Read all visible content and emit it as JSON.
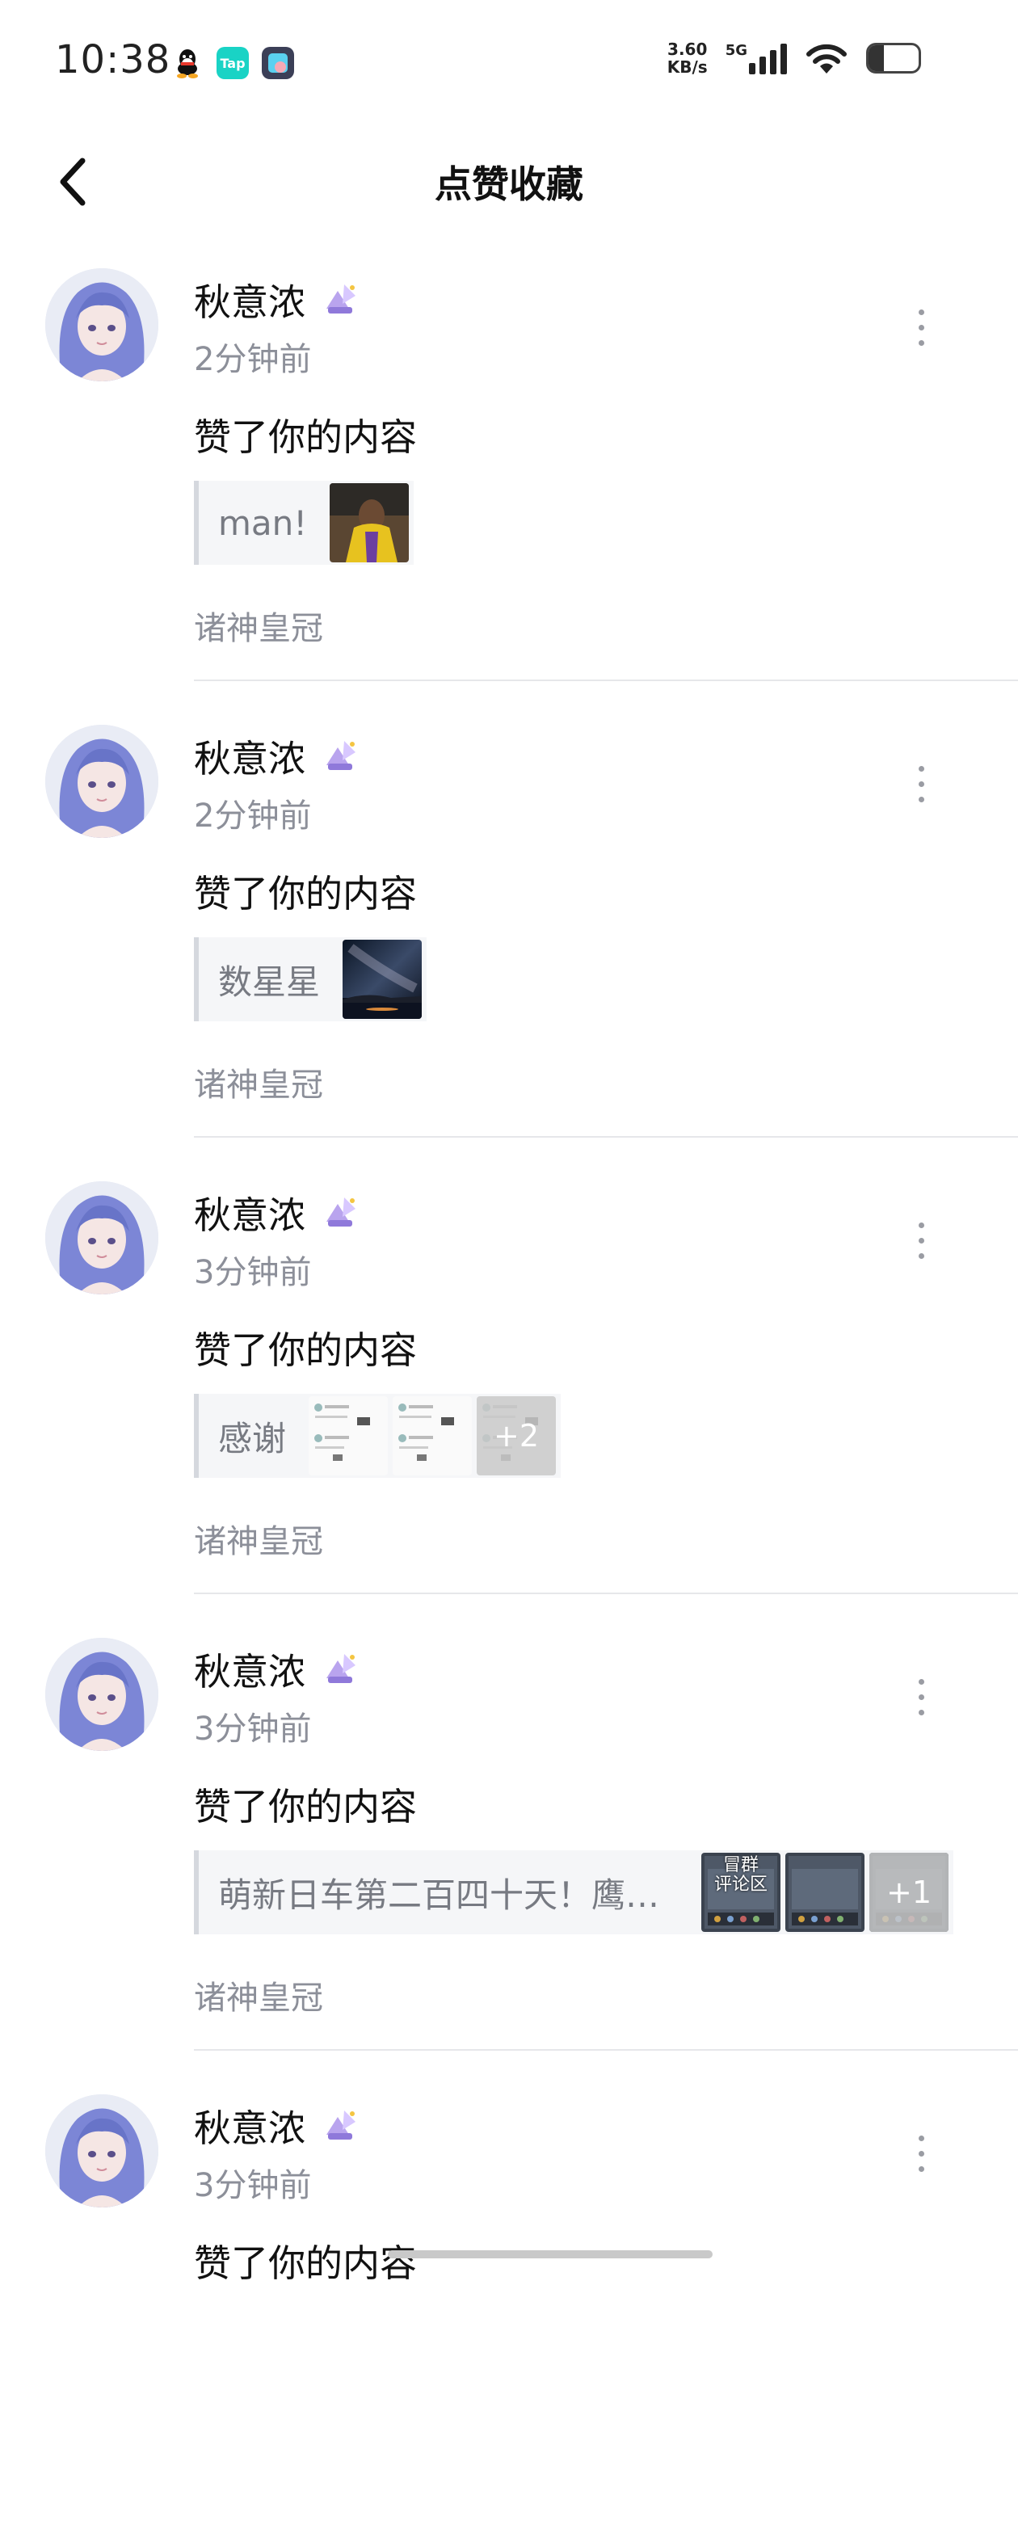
{
  "status_bar": {
    "time": "10:38",
    "net_speed_value": "3.60",
    "net_speed_unit": "KB/s",
    "network": "5G",
    "notification_icons": [
      "qq-icon",
      "taptap-icon",
      "app-icon"
    ],
    "signal_bars": 4,
    "battery_level": 0.3
  },
  "header": {
    "title": "点赞收藏",
    "back_icon": "back-arrow-icon"
  },
  "feed": [
    {
      "user": "秋意浓",
      "time_ago": "2分钟前",
      "action": "赞了你的内容",
      "ref_text": "man!",
      "thumbs": [
        "basketball-photo"
      ],
      "extra_count": "",
      "community": "诸神皇冠"
    },
    {
      "user": "秋意浓",
      "time_ago": "2分钟前",
      "action": "赞了你的内容",
      "ref_text": "数星星",
      "thumbs": [
        "starry-sky-photo"
      ],
      "extra_count": "",
      "community": "诸神皇冠"
    },
    {
      "user": "秋意浓",
      "time_ago": "3分钟前",
      "action": "赞了你的内容",
      "ref_text": "感谢",
      "thumbs": [
        "screenshot-thumb",
        "screenshot-thumb",
        "screenshot-thumb"
      ],
      "extra_count": "+2",
      "community": "诸神皇冠"
    },
    {
      "user": "秋意浓",
      "time_ago": "3分钟前",
      "action": "赞了你的内容",
      "ref_text": "萌新日车第二百四十天！鹰…",
      "thumbs": [
        "game-screenshot",
        "game-screenshot",
        "game-screenshot"
      ],
      "thumb_caption": "冒群\n评论区",
      "extra_count": "+1",
      "community": "诸神皇冠"
    },
    {
      "user": "秋意浓",
      "time_ago": "3分钟前",
      "action": "赞了你的内容",
      "ref_text": "",
      "thumbs": [],
      "extra_count": "",
      "community": ""
    }
  ]
}
